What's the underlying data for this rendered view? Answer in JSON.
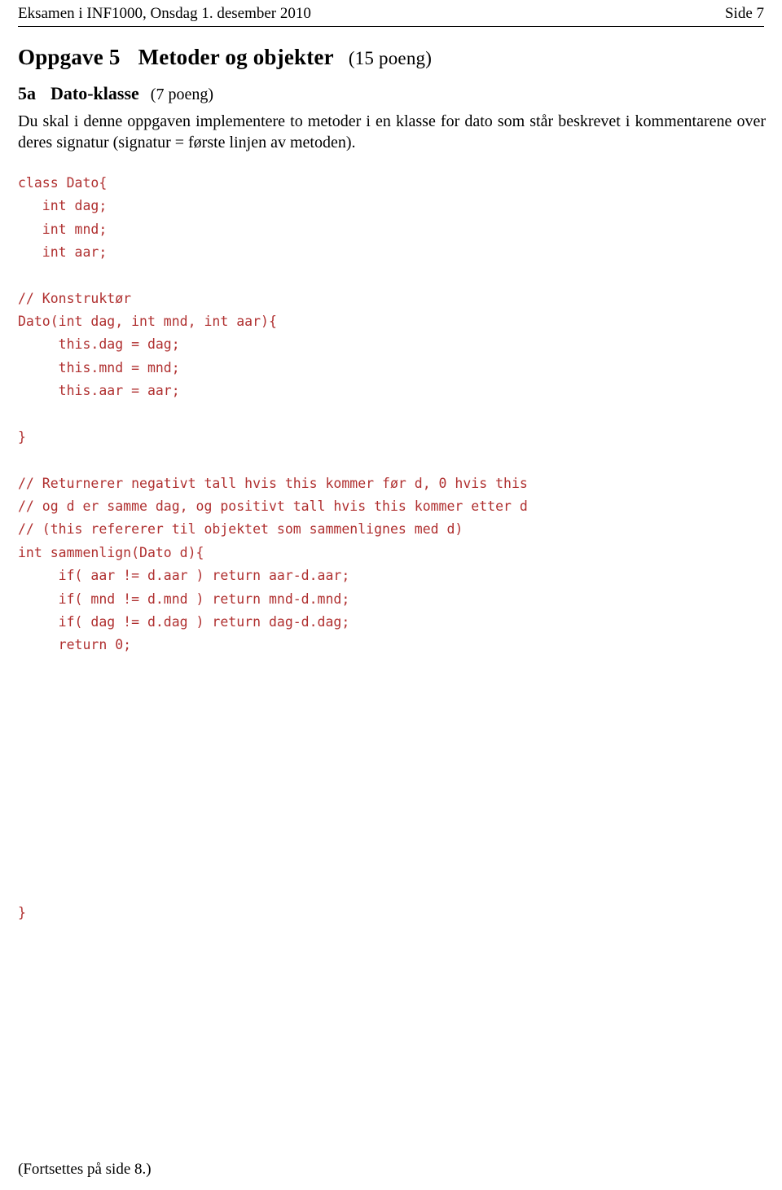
{
  "header": {
    "left": "Eksamen i INF1000, Onsdag 1. desember 2010",
    "right": "Side 7"
  },
  "task": {
    "number": "Oppgave 5",
    "title": "Metoder og objekter",
    "points": "(15 poeng)"
  },
  "subtask": {
    "number": "5a",
    "title": "Dato-klasse",
    "points": "(7 poeng)"
  },
  "intro": "Du skal i denne oppgaven implementere to metoder i en klasse for dato som står beskrevet i kommentarene over deres signatur (signatur = første linjen av metoden).",
  "code": {
    "lines": [
      "class Dato{",
      "   int dag;",
      "   int mnd;",
      "   int aar;",
      "",
      "// Konstruktør",
      "Dato(int dag, int mnd, int aar){",
      "     this.dag = dag;",
      "     this.mnd = mnd;",
      "     this.aar = aar;",
      "",
      "}",
      "",
      "// Returnerer negativt tall hvis this kommer før d, 0 hvis this",
      "// og d er samme dag, og positivt tall hvis this kommer etter d",
      "// (this refererer til objektet som sammenlignes med d)",
      "int sammenlign(Dato d){",
      "     if( aar != d.aar ) return aar-d.aar;",
      "     if( mnd != d.mnd ) return mnd-d.mnd;",
      "     if( dag != d.dag ) return dag-d.dag;",
      "     return 0;"
    ],
    "closing_brace": "}"
  },
  "footer": "(Fortsettes på side 8.)"
}
